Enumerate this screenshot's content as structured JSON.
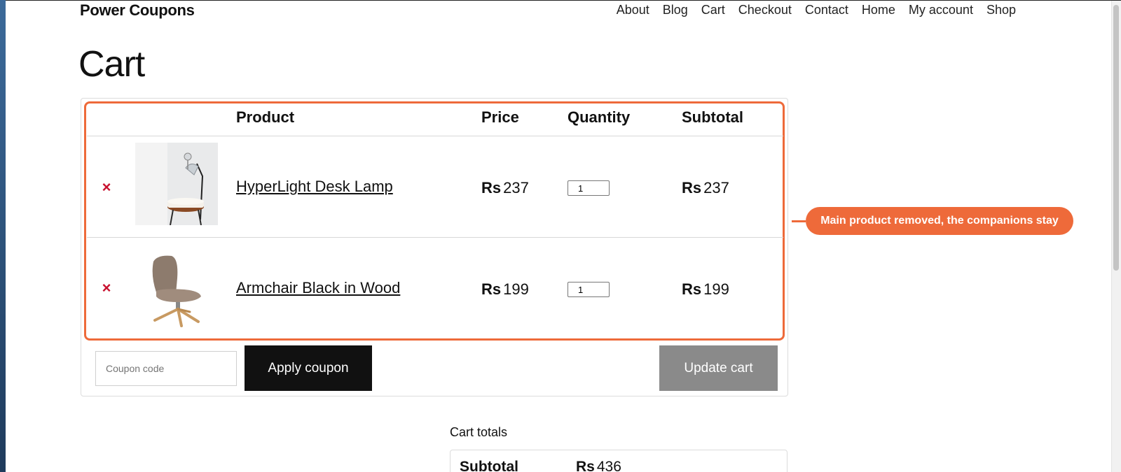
{
  "header": {
    "site_title": "Power Coupons",
    "nav": [
      "About",
      "Blog",
      "Cart",
      "Checkout",
      "Contact",
      "Home",
      "My account",
      "Shop"
    ]
  },
  "page": {
    "title": "Cart"
  },
  "table": {
    "headers": {
      "product": "Product",
      "price": "Price",
      "quantity": "Quantity",
      "subtotal": "Subtotal"
    },
    "rows": [
      {
        "remove": "×",
        "image": "desk-lamp-thumbnail",
        "name": "HyperLight Desk Lamp",
        "price_currency": "Rs",
        "price": "237",
        "quantity": "1",
        "subtotal_currency": "Rs",
        "subtotal": "237"
      },
      {
        "remove": "×",
        "image": "armchair-thumbnail",
        "name": "Armchair Black in Wood",
        "price_currency": "Rs",
        "price": "199",
        "quantity": "1",
        "subtotal_currency": "Rs",
        "subtotal": "199"
      }
    ]
  },
  "coupon": {
    "placeholder": "Coupon code",
    "apply_label": "Apply coupon"
  },
  "update_label": "Update cart",
  "annotation": {
    "text": "Main product removed, the companions stay"
  },
  "totals": {
    "title": "Cart totals",
    "subtotal_label": "Subtotal",
    "subtotal_currency": "Rs",
    "subtotal_value": "436"
  },
  "colors": {
    "accent": "#ee6a3a",
    "remove": "#c8102e",
    "apply_button": "#111111",
    "update_button": "#8a8a8a"
  }
}
